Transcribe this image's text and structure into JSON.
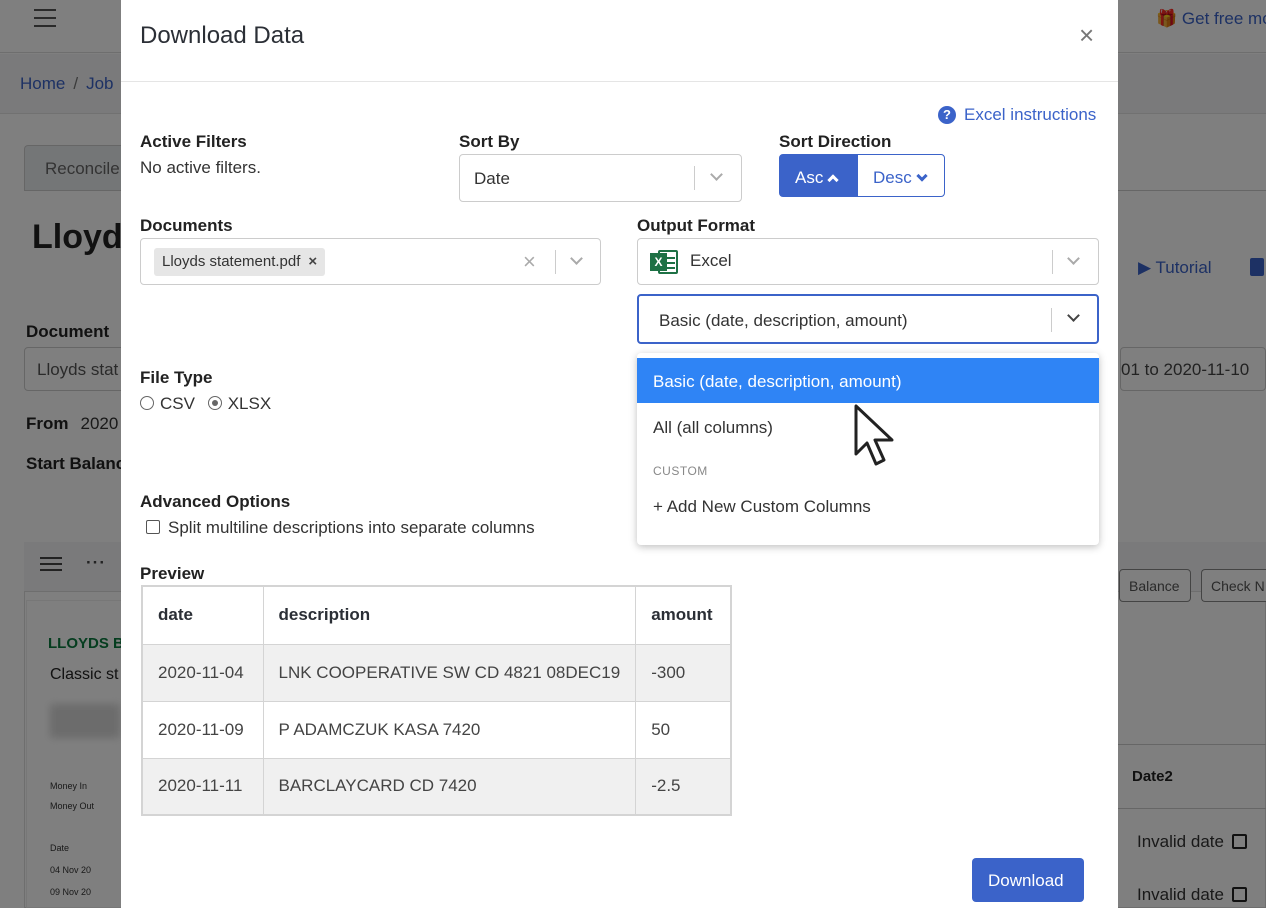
{
  "background": {
    "get_free": "Get free mo",
    "breadcrumb": {
      "home": "Home",
      "jobs": "Job"
    },
    "tab": "Reconcile",
    "title": "Lloyds",
    "document_label": "Document",
    "document_value": "Lloyds stat",
    "from_label": "From",
    "from_value": "2020",
    "start_balance_label": "Start Balanc",
    "date_range": "01 to 2020-11-10",
    "tutorial": "Tutorial",
    "balance_button": "Balance",
    "check_button": "Check N",
    "statement": {
      "bank": "LLOYDS B",
      "classic": "Classic st",
      "money_in": "Money In",
      "money_out": "Money Out",
      "date_header": "Date",
      "row1": "04 Nov 20",
      "row2": "09 Nov 20"
    },
    "date2_header": "Date2",
    "invalid_date": "Invalid date"
  },
  "modal": {
    "title": "Download Data",
    "close": "×",
    "excel_instructions": "Excel instructions",
    "active_filters_label": "Active Filters",
    "active_filters_value": "No active filters.",
    "sort_by_label": "Sort By",
    "sort_by_value": "Date",
    "sort_direction_label": "Sort Direction",
    "asc_label": "Asc",
    "desc_label": "Desc",
    "documents_label": "Documents",
    "document_chip": "Lloyds statement.pdf",
    "output_format_label": "Output Format",
    "output_format_value": "Excel",
    "columns_value": "Basic (date, description, amount)",
    "file_type_label": "File Type",
    "file_type_csv": "CSV",
    "file_type_xlsx": "XLSX",
    "advanced_label": "Advanced Options",
    "split_multiline": "Split multiline descriptions into separate columns",
    "preview_label": "Preview",
    "preview": {
      "headers": [
        "date",
        "description",
        "amount"
      ],
      "rows": [
        [
          "2020-11-04",
          "LNK COOPERATIVE SW CD 4821 08DEC19",
          "-300"
        ],
        [
          "2020-11-09",
          "P ADAMCZUK KASA 7420",
          "50"
        ],
        [
          "2020-11-11",
          "BARCLAYCARD CD 7420",
          "-2.5"
        ]
      ]
    },
    "download": "Download"
  },
  "menu": {
    "options": [
      "Basic (date, description, amount)",
      "All (all columns)"
    ],
    "group_label": "CUSTOM",
    "add_custom": "+ Add New Custom Columns",
    "active_index": 0
  },
  "colors": {
    "primary": "#3b63c9",
    "highlight": "#2f84f5",
    "excel_green": "#1e7145"
  }
}
